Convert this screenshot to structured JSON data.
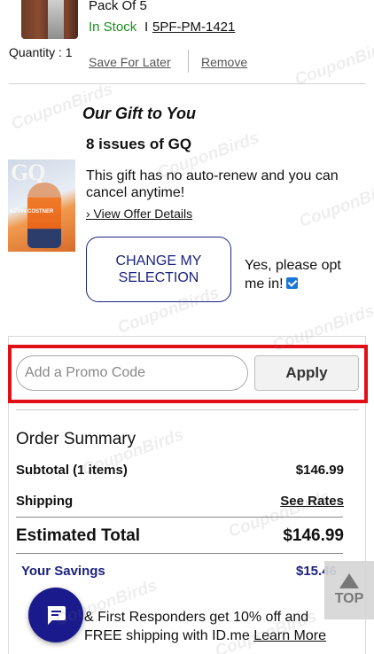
{
  "product": {
    "pack": "Pack Of 5",
    "stock": "In Stock",
    "separator": "I",
    "sku": "5PF-PM-1421",
    "quantity": "Quantity : 1",
    "save_for_later": "Save For Later",
    "remove": "Remove"
  },
  "gift": {
    "title": "Our Gift to You",
    "issues": "8 issues of GQ",
    "description": "This gift has no auto-renew and you can cancel anytime!",
    "offer_link": "› View Offer Details",
    "change_button": "CHANGE MY SELECTION",
    "optin_label": "Yes, please opt me in!",
    "optin_checked": true,
    "cover_logo": "GQ",
    "cover_text": "KEVIN COSTNER"
  },
  "promo": {
    "placeholder": "Add a Promo Code",
    "apply": "Apply"
  },
  "summary": {
    "title": "Order Summary",
    "subtotal_label": "Subtotal (1 items)",
    "subtotal_value": "$146.99",
    "shipping_label": "Shipping",
    "shipping_value": "See Rates",
    "estimated_label": "Estimated Total",
    "estimated_value": "$146.99",
    "savings_label": "Your Savings",
    "savings_value": "$15.46"
  },
  "promo_banner": {
    "text": "& First Responders get 10% off and FREE shipping with ID.me",
    "link": "Learn More"
  },
  "floating": {
    "top_label": "TOP",
    "chat_icon": "chat-bubble-icon"
  },
  "watermark": "CouponBirds",
  "colors": {
    "in_stock": "#1a8f1a",
    "accent_navy": "#1a237e",
    "highlight_red": "#e10f17",
    "chat_fab": "#1a1a8c"
  }
}
